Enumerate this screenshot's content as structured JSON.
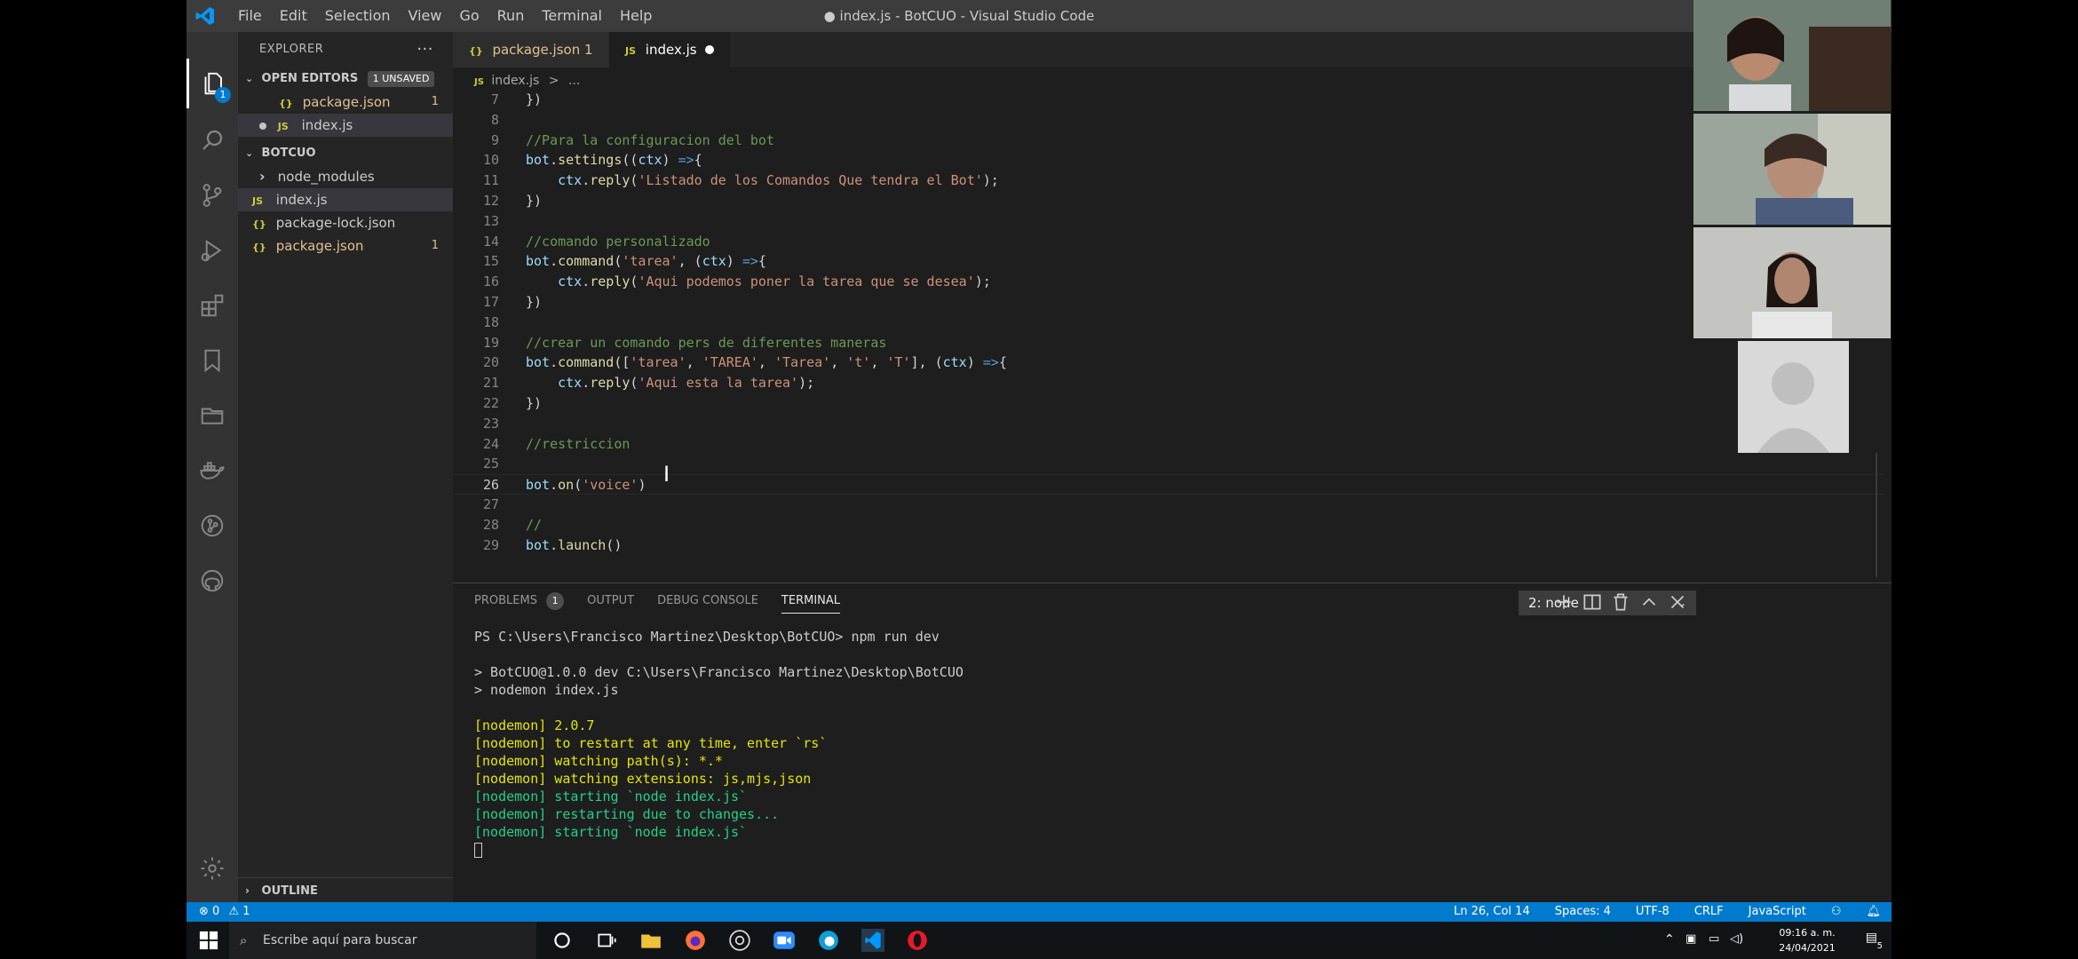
{
  "app": {
    "menu": [
      "File",
      "Edit",
      "Selection",
      "View",
      "Go",
      "Run",
      "Terminal",
      "Help"
    ],
    "window_title": "● index.js - BotCUO - Visual Studio Code"
  },
  "activity_bar": {
    "explorer_badge": "1"
  },
  "sidebar": {
    "header": "EXPLORER",
    "more": "···",
    "open_editors": {
      "title": "OPEN EDITORS",
      "badge": "1 UNSAVED",
      "items": [
        {
          "icon": "{}",
          "name": "package.json",
          "count": "1"
        },
        {
          "icon": "JS",
          "name": "index.js"
        }
      ]
    },
    "project": {
      "title": "BOTCUO",
      "items": [
        {
          "icon": "›",
          "name": "node_modules"
        },
        {
          "icon": "JS",
          "name": "index.js"
        },
        {
          "icon": "{}",
          "name": "package-lock.json"
        },
        {
          "icon": "{}",
          "name": "package.json",
          "count": "1"
        }
      ]
    },
    "outline": "OUTLINE"
  },
  "tabs": [
    {
      "icon": "{}",
      "label": "package.json 1"
    },
    {
      "icon": "JS",
      "label": "index.js"
    }
  ],
  "breadcrumb": {
    "icon": "JS",
    "file": "index.js",
    "sep": ">",
    "rest": "..."
  },
  "code": {
    "lines": [
      {
        "n": "7",
        "t": "})"
      },
      {
        "n": "8",
        "t": ""
      },
      {
        "n": "9",
        "t": "//Para la configuracion del bot"
      },
      {
        "n": "10",
        "t": "bot.settings((ctx) =>{"
      },
      {
        "n": "11",
        "t": "    ctx.reply('Listado de los Comandos Que tendra el Bot');"
      },
      {
        "n": "12",
        "t": "})"
      },
      {
        "n": "13",
        "t": ""
      },
      {
        "n": "14",
        "t": "//comando personalizado"
      },
      {
        "n": "15",
        "t": "bot.command('tarea', (ctx) =>{"
      },
      {
        "n": "16",
        "t": "    ctx.reply('Aqui podemos poner la tarea que se desea');"
      },
      {
        "n": "17",
        "t": "})"
      },
      {
        "n": "18",
        "t": ""
      },
      {
        "n": "19",
        "t": "//crear un comando pers de diferentes maneras"
      },
      {
        "n": "20",
        "t": "bot.command(['tarea', 'TAREA', 'Tarea', 't', 'T'], (ctx) =>{"
      },
      {
        "n": "21",
        "t": "    ctx.reply('Aqui esta la tarea');"
      },
      {
        "n": "22",
        "t": "})"
      },
      {
        "n": "23",
        "t": ""
      },
      {
        "n": "24",
        "t": "//restriccion"
      },
      {
        "n": "25",
        "t": ""
      },
      {
        "n": "26",
        "t": "bot.on('voice')"
      },
      {
        "n": "27",
        "t": ""
      },
      {
        "n": "28",
        "t": "//"
      },
      {
        "n": "29",
        "t": "bot.launch()"
      }
    ]
  },
  "panel": {
    "tabs": [
      {
        "label": "PROBLEMS",
        "badge": "1"
      },
      {
        "label": "OUTPUT"
      },
      {
        "label": "DEBUG CONSOLE"
      },
      {
        "label": "TERMINAL"
      }
    ],
    "terminal_select": "2: node",
    "terminal_lines": [
      {
        "c": "",
        "t": "PS C:\\Users\\Francisco Martinez\\Desktop\\BotCUO> npm run dev"
      },
      {
        "c": "",
        "t": ""
      },
      {
        "c": "",
        "t": "> BotCUO@1.0.0 dev C:\\Users\\Francisco Martinez\\Desktop\\BotCUO"
      },
      {
        "c": "",
        "t": "> nodemon index.js"
      },
      {
        "c": "",
        "t": ""
      },
      {
        "c": "y",
        "t": "[nodemon] 2.0.7"
      },
      {
        "c": "y",
        "t": "[nodemon] to restart at any time, enter `rs`"
      },
      {
        "c": "y",
        "t": "[nodemon] watching path(s): *.*"
      },
      {
        "c": "y",
        "t": "[nodemon] watching extensions: js,mjs,json"
      },
      {
        "c": "g",
        "t": "[nodemon] starting `node index.js`"
      },
      {
        "c": "g",
        "t": "[nodemon] restarting due to changes..."
      },
      {
        "c": "g",
        "t": "[nodemon] starting `node index.js`"
      }
    ]
  },
  "status": {
    "errors": "⊗ 0",
    "warnings": "⚠ 1",
    "position": "Ln 26, Col 14",
    "spaces": "Spaces: 4",
    "encoding": "UTF-8",
    "eol": "CRLF",
    "language": "JavaScript"
  },
  "taskbar": {
    "search_placeholder": "Escribe aquí para buscar",
    "time": "09:16 a. m.",
    "date": "24/04/2021",
    "notif_count": "5"
  },
  "colors": {
    "accent": "#007acc",
    "titlebar": "#3c3c3c",
    "editor_bg": "#1e1e1e",
    "sidebar_bg": "#252526"
  }
}
